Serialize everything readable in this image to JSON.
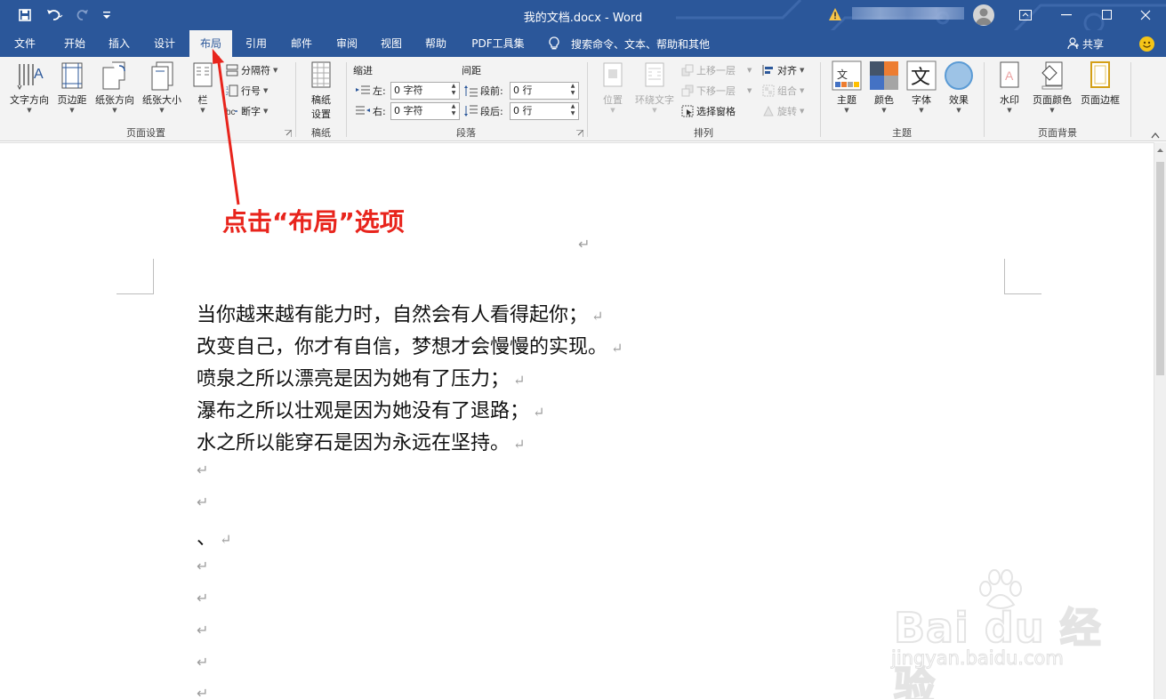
{
  "titlebar": {
    "doc_title": "我的文档.docx  -  Word",
    "undo_icon": "undo-icon",
    "redo_icon": "redo-icon"
  },
  "tabs": [
    {
      "label": "文件"
    },
    {
      "label": "开始"
    },
    {
      "label": "插入"
    },
    {
      "label": "设计"
    },
    {
      "label": "布局",
      "active": true
    },
    {
      "label": "引用"
    },
    {
      "label": "邮件"
    },
    {
      "label": "审阅"
    },
    {
      "label": "视图"
    },
    {
      "label": "帮助"
    },
    {
      "label": "PDF工具集"
    }
  ],
  "tell_me": "搜索命令、文本、帮助和其他",
  "share": "共享",
  "ribbon": {
    "page_setup": {
      "label": "页面设置",
      "text_direction": "文字方向",
      "margins": "页边距",
      "orientation": "纸张方向",
      "size": "纸张大小",
      "columns": "栏",
      "breaks": "分隔符",
      "line_numbers": "行号",
      "hyphenation": "断字"
    },
    "manuscript": {
      "label": "稿纸",
      "button_line1": "稿纸",
      "button_line2": "设置"
    },
    "paragraph": {
      "label": "段落",
      "indent_header": "缩进",
      "spacing_header": "间距",
      "left_label": "左:",
      "left_value": "0 字符",
      "right_label": "右:",
      "right_value": "0 字符",
      "before_label": "段前:",
      "before_value": "0 行",
      "after_label": "段后:",
      "after_value": "0 行"
    },
    "arrange": {
      "label": "排列",
      "position": "位置",
      "wrap_text": "环绕文字",
      "bring_forward": "上移一层",
      "send_backward": "下移一层",
      "selection_pane": "选择窗格",
      "align": "对齐",
      "group": "组合",
      "rotate": "旋转"
    },
    "theme": {
      "label": "主题",
      "themes": "主题",
      "colors": "颜色",
      "fonts": "字体",
      "effects": "效果"
    },
    "background": {
      "label": "页面背景",
      "watermark": "水印",
      "page_color": "页面颜色",
      "page_borders": "页面边框"
    }
  },
  "document": {
    "lines": [
      "当你越来越有能力时，自然会有人看得起你；",
      "改变自己，你才有自信，梦想才会慢慢的实现。",
      "喷泉之所以漂亮是因为她有了压力；",
      "瀑布之所以壮观是因为她没有了退路；",
      "水之所以能穿石是因为永远在坚持。"
    ],
    "comma_line": "、",
    "para_mark": "↵"
  },
  "annotation": "点击“布局”选项",
  "watermark": {
    "big": "Bai du 经验",
    "small": "jingyan.baidu.com"
  },
  "colors": {
    "title_bar": "#2b579a",
    "annotation": "#e8241c"
  }
}
